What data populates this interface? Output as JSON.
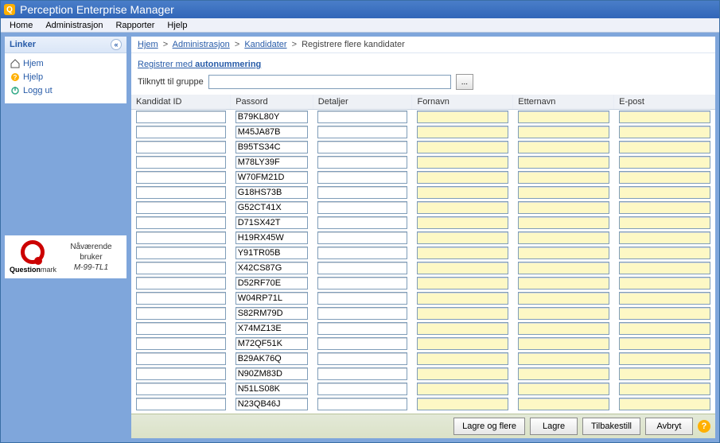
{
  "app": {
    "title": "Perception Enterprise Manager"
  },
  "menu": {
    "home": "Home",
    "admin": "Administrasjon",
    "reports": "Rapporter",
    "help": "Hjelp"
  },
  "sidebar": {
    "heading": "Linker",
    "items": [
      {
        "label": "Hjem"
      },
      {
        "label": "Hjelp"
      },
      {
        "label": "Logg ut"
      }
    ]
  },
  "user": {
    "label": "Nåværende bruker",
    "name": "M-99-TL1",
    "brand1": "Question",
    "brand2": "mark"
  },
  "breadcrumb": {
    "hjem": "Hjem",
    "admin": "Administrasjon",
    "kand": "Kandidater",
    "here": "Registrere flere kandidater",
    "sep": ">"
  },
  "toplinks": {
    "reg_prefix": "Registrer med ",
    "reg_auto": "autonummering"
  },
  "group": {
    "label": "Tilknytt til gruppe",
    "value": "",
    "browse": "..."
  },
  "columns": {
    "id": "Kandidat ID",
    "pwd": "Passord",
    "det": "Detaljer",
    "fn": "Fornavn",
    "en": "Etternavn",
    "ep": "E-post"
  },
  "rows": [
    {
      "id": "",
      "pwd": "B79KL80Y"
    },
    {
      "id": "",
      "pwd": "M45JA87B"
    },
    {
      "id": "",
      "pwd": "B95TS34C"
    },
    {
      "id": "",
      "pwd": "M78LY39F"
    },
    {
      "id": "",
      "pwd": "W70FM21D"
    },
    {
      "id": "",
      "pwd": "G18HS73B"
    },
    {
      "id": "",
      "pwd": "G52CT41X"
    },
    {
      "id": "",
      "pwd": "D71SX42T"
    },
    {
      "id": "",
      "pwd": "H19RX45W"
    },
    {
      "id": "",
      "pwd": "Y91TR05B"
    },
    {
      "id": "",
      "pwd": "X42CS87G"
    },
    {
      "id": "",
      "pwd": "D52RF70E"
    },
    {
      "id": "",
      "pwd": "W04RP71L"
    },
    {
      "id": "",
      "pwd": "S82RM79D"
    },
    {
      "id": "",
      "pwd": "X74MZ13E"
    },
    {
      "id": "",
      "pwd": "M72QF51K"
    },
    {
      "id": "",
      "pwd": "B29AK76Q"
    },
    {
      "id": "",
      "pwd": "N90ZM83D"
    },
    {
      "id": "",
      "pwd": "N51LS08K"
    },
    {
      "id": "",
      "pwd": "N23QB46J"
    }
  ],
  "footer": {
    "save_more": "Lagre og flere",
    "save": "Lagre",
    "reset": "Tilbakestill",
    "cancel": "Avbryt"
  }
}
